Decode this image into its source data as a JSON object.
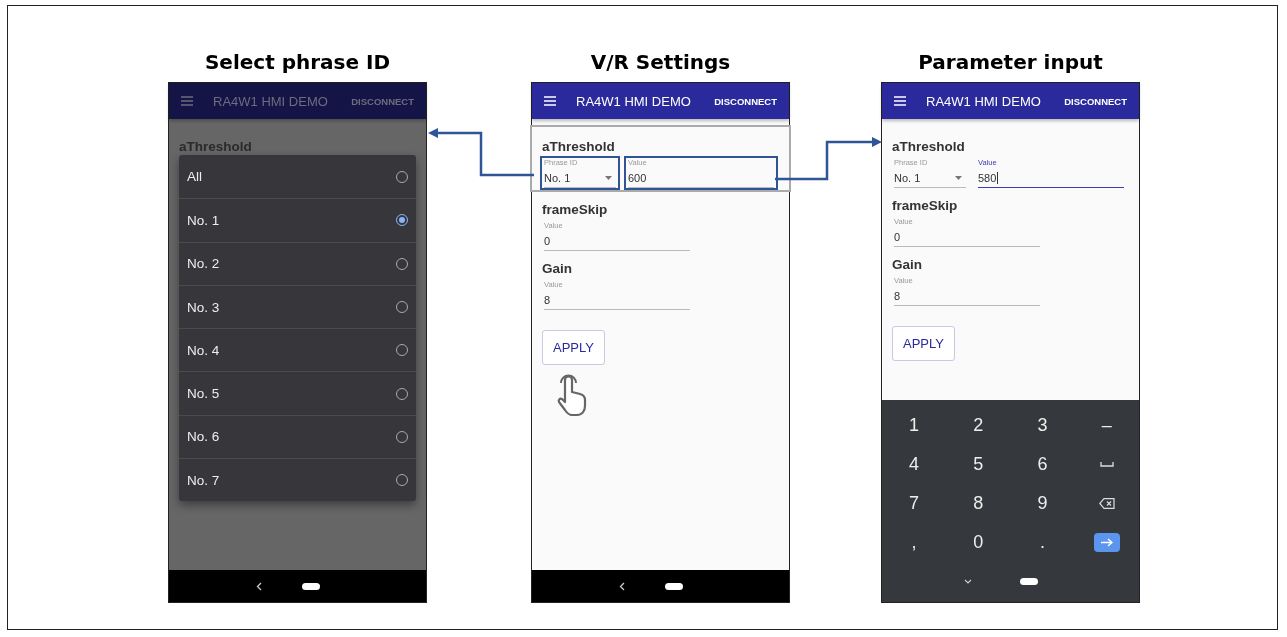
{
  "panels": [
    {
      "kind": "picker",
      "title": "Select phrase ID",
      "app_bar": {
        "title": "RA4W1 HMI DEMO",
        "action": "DISCONNECT"
      },
      "section": "aThreshold",
      "options": [
        {
          "label": "All",
          "selected": false
        },
        {
          "label": "No. 1",
          "selected": true
        },
        {
          "label": "No. 2",
          "selected": false
        },
        {
          "label": "No. 3",
          "selected": false
        },
        {
          "label": "No. 4",
          "selected": false
        },
        {
          "label": "No. 5",
          "selected": false
        },
        {
          "label": "No. 6",
          "selected": false
        },
        {
          "label": "No. 7",
          "selected": false
        }
      ]
    },
    {
      "kind": "form",
      "title": "V/R Settings",
      "app_bar": {
        "title": "RA4W1 HMI DEMO",
        "action": "DISCONNECT"
      },
      "button": "APPLY",
      "pointer": true,
      "sections": [
        {
          "heading": "aThreshold",
          "highlighted": true,
          "fields": [
            {
              "kind": "select",
              "label": "Phrase ID",
              "value": "No. 1",
              "focused": false,
              "highlighted": true
            },
            {
              "kind": "text",
              "label": "Value",
              "value": "600",
              "focused": false,
              "highlighted": true
            }
          ]
        },
        {
          "heading": "frameSkip",
          "highlighted": false,
          "fields": [
            {
              "kind": "text",
              "label": "Value",
              "value": "0",
              "focused": false,
              "highlighted": false
            }
          ]
        },
        {
          "heading": "Gain",
          "highlighted": false,
          "fields": [
            {
              "kind": "text",
              "label": "Value",
              "value": "8",
              "focused": false,
              "highlighted": false
            }
          ]
        }
      ]
    },
    {
      "kind": "form",
      "title": "Parameter input",
      "app_bar": {
        "title": "RA4W1 HMI DEMO",
        "action": "DISCONNECT"
      },
      "button": "APPLY",
      "pointer": false,
      "sections": [
        {
          "heading": "aThreshold",
          "highlighted": false,
          "fields": [
            {
              "kind": "select",
              "label": "Phrase ID",
              "value": "No. 1",
              "focused": false,
              "highlighted": false
            },
            {
              "kind": "text",
              "label": "Value",
              "value": "580",
              "focused": true,
              "highlighted": false
            }
          ]
        },
        {
          "heading": "frameSkip",
          "highlighted": false,
          "fields": [
            {
              "kind": "text",
              "label": "Value",
              "value": "0",
              "focused": false,
              "highlighted": false
            }
          ]
        },
        {
          "heading": "Gain",
          "highlighted": false,
          "fields": [
            {
              "kind": "text",
              "label": "Value",
              "value": "8",
              "focused": false,
              "highlighted": false
            }
          ]
        }
      ],
      "keyboard": [
        {
          "kind": "char",
          "label": "1"
        },
        {
          "kind": "char",
          "label": "2"
        },
        {
          "kind": "char",
          "label": "3"
        },
        {
          "kind": "char",
          "label": "–"
        },
        {
          "kind": "char",
          "label": "4"
        },
        {
          "kind": "char",
          "label": "5"
        },
        {
          "kind": "char",
          "label": "6"
        },
        {
          "kind": "space"
        },
        {
          "kind": "char",
          "label": "7"
        },
        {
          "kind": "char",
          "label": "8"
        },
        {
          "kind": "char",
          "label": "9"
        },
        {
          "kind": "backspace"
        },
        {
          "kind": "char",
          "label": ","
        },
        {
          "kind": "char",
          "label": "0"
        },
        {
          "kind": "char",
          "label": "."
        },
        {
          "kind": "enter"
        }
      ]
    }
  ]
}
